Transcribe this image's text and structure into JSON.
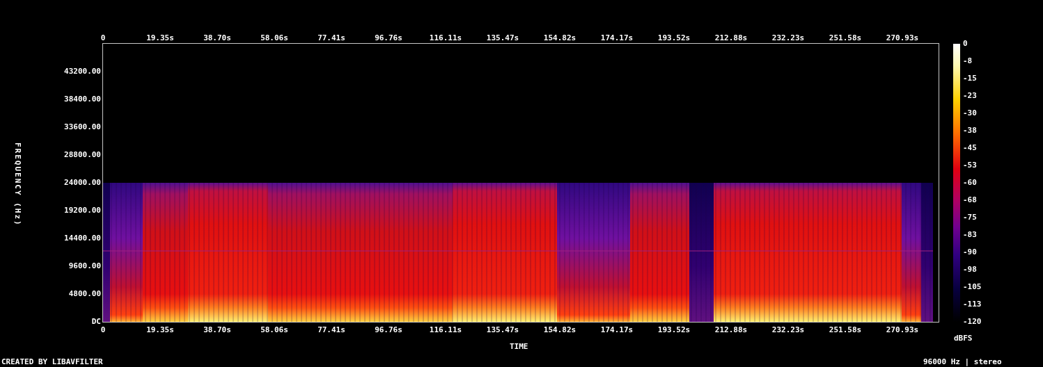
{
  "time_axis": {
    "title": "TIME",
    "top_labels": [
      "0",
      "19.35s",
      "38.70s",
      "58.06s",
      "77.41s",
      "96.76s",
      "116.11s",
      "135.47s",
      "154.82s",
      "174.17s",
      "193.52s",
      "212.88s",
      "232.23s",
      "251.58s",
      "270.93s"
    ],
    "bottom_labels": [
      "0",
      "19.35s",
      "38.70s",
      "58.06s",
      "77.41s",
      "96.76s",
      "116.11s",
      "135.47s",
      "154.82s",
      "174.17s",
      "193.52s",
      "212.88s",
      "232.23s",
      "251.58s",
      "270.93s"
    ]
  },
  "frequency_axis": {
    "title": "FREQUENCY (Hz)",
    "labels": [
      "43200.00",
      "38400.00",
      "33600.00",
      "28800.00",
      "24000.00",
      "19200.00",
      "14400.00",
      "9600.00",
      "4800.00",
      "DC"
    ]
  },
  "color_scale": {
    "unit": "dBFS",
    "labels": [
      "0",
      "-8",
      "-15",
      "-23",
      "-30",
      "-38",
      "-45",
      "-53",
      "-60",
      "-68",
      "-75",
      "-83",
      "-90",
      "-98",
      "-105",
      "-113",
      "-120"
    ]
  },
  "footer": {
    "credit": "CREATED BY LIBAVFILTER",
    "info": "96000 Hz | stereo"
  }
}
